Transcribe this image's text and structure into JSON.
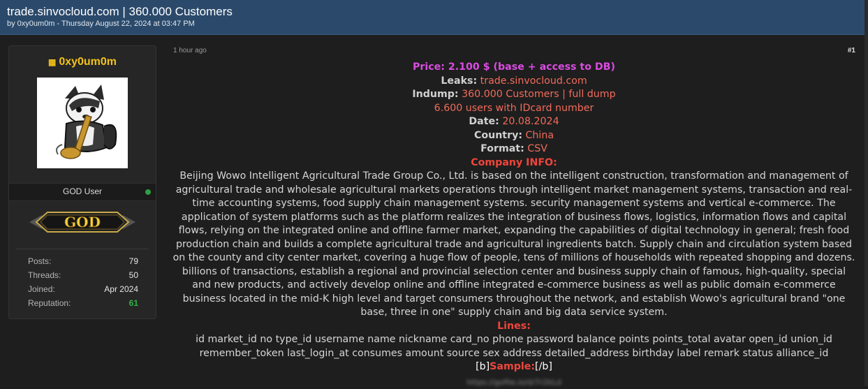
{
  "thread": {
    "title": "trade.sinvocloud.com | 360.000 Customers",
    "byline": "by 0xy0um0m - Thursday August 22, 2024 at 03:47 PM"
  },
  "author": {
    "username": "0xy0um0m",
    "rank": "GOD User",
    "badge_text": "GOD",
    "stats": [
      {
        "label": "Posts:",
        "value": "79"
      },
      {
        "label": "Threads:",
        "value": "50"
      },
      {
        "label": "Joined:",
        "value": "Apr 2024"
      },
      {
        "label": "Reputation:",
        "value": "61"
      }
    ]
  },
  "post": {
    "time": "1 hour ago",
    "number": "#1",
    "price": "Price: 2.100 $ (base + access to DB)",
    "leaks_label": "Leaks:",
    "leaks_value": "trade.sinvocloud.com",
    "indump_label": "Indump:",
    "indump_value": "360.000 Customers | full dump",
    "idcard_line": "6.600 users with IDcard number",
    "date_label": "Date:",
    "date_value": "20.08.2024",
    "country_label": "Country:",
    "country_value": "China",
    "format_label": "Format:",
    "format_value": "CSV",
    "company_heading": "Company INFO:",
    "company_text": "Beijing Wowo Intelligent Agricultural Trade Group Co., Ltd. is based on the intelligent construction, transformation and management of agricultural trade and wholesale agricultural markets operations through intelligent market management systems, transaction and real-time accounting systems, food supply chain management systems. security management systems and vertical e-commerce. The application of system platforms such as the platform realizes the integration of business flows, logistics, information flows and capital flows, relying on the integrated online and offline farmer market, expanding the capabilities of digital technology in general; fresh food production chain and builds a complete agricultural trade and agricultural ingredients batch. Supply chain and circulation system based on the county and city center market, covering a huge flow of people, tens of millions of households with repeated shopping and dozens. billions of transactions, establish a regional and provincial selection center and business supply chain of famous, high-quality, special and new products, and actively develop online and offline integrated e-commerce business as well as public domain e-commerce business located in the mid-K high level and target consumers throughout the network, and establish Wowo's agricultural brand \"one base, three in one\" supply chain and big data service system.",
    "lines_heading": "Lines:",
    "lines_text": "id market_id no type_id username name nickname card_no phone password balance points points_total avatar open_id union_id remember_token last_login_at consumes amount source sex address detailed_address birthday label remark status alliance_id",
    "sample_open": "[b]",
    "sample_heading": "Sample:",
    "sample_close": "[/b]",
    "sample_link": "https://gofile.io/d/7r2kLd"
  },
  "colors": {
    "header_bg": "#2b4a6b",
    "username": "#f2c21b",
    "price": "#d94ce0",
    "value": "#f26b5b",
    "heading": "#f0453a",
    "reputation": "#2fb344"
  }
}
